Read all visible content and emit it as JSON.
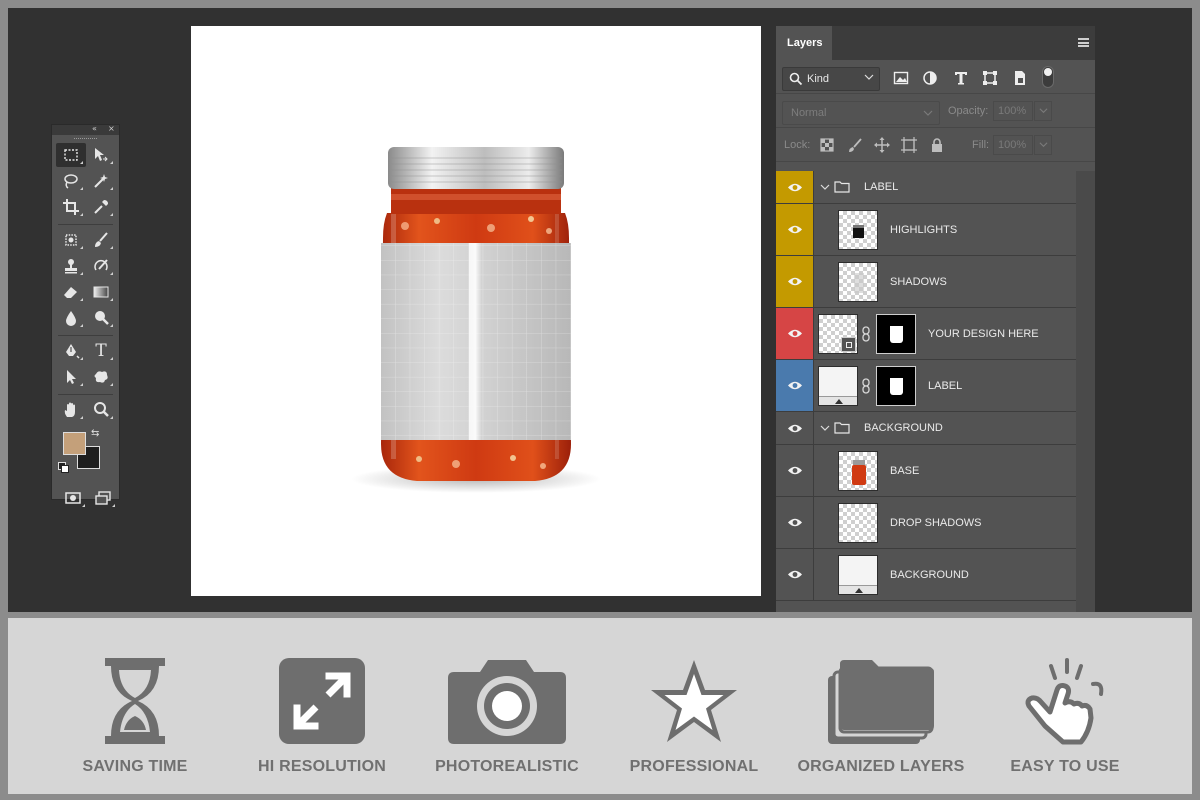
{
  "colors": {
    "workspace_bg": "#313131",
    "panel_bg": "#535353",
    "feature_bar_bg": "#d6d6d6",
    "feature_icon": "#6e6e6e",
    "foreground_swatch": "#c4a07a",
    "background_swatch": "#1e1e1e",
    "label_gold": "#c49a00",
    "label_red": "#d64545",
    "label_blue": "#4a7aad"
  },
  "tools_panel": {
    "collapse_glyph": "«",
    "close_glyph": "×",
    "tools": [
      [
        "marquee-icon",
        "move-icon"
      ],
      [
        "lasso-icon",
        "magic-wand-icon"
      ],
      [
        "crop-icon",
        "eyedropper-icon"
      ],
      [
        "healing-icon",
        "brush-icon"
      ],
      [
        "stamp-icon",
        "history-brush-icon"
      ],
      [
        "eraser-icon",
        "gradient-icon"
      ],
      [
        "blur-icon",
        "dodge-icon"
      ],
      [
        "pen-icon",
        "type-icon"
      ],
      [
        "path-select-icon",
        "shape-icon"
      ],
      [
        "hand-icon",
        "zoom-icon"
      ]
    ],
    "type_tool_glyph": "T",
    "swap_glyph": "⇆"
  },
  "layers_panel": {
    "tab_label": "Layers",
    "filter_kind": "Kind",
    "blend_mode": "Normal",
    "opacity_label": "Opacity:",
    "opacity_value": "100%",
    "lock_label": "Lock:",
    "fill_label": "Fill:",
    "fill_value": "100%",
    "layers": [
      {
        "name": "LABEL",
        "kind": "group",
        "label_color": "gold",
        "indent": 0
      },
      {
        "name": "HIGHLIGHTS",
        "kind": "layer",
        "label_color": "gold",
        "indent": 1,
        "thumb": "highlights"
      },
      {
        "name": "SHADOWS",
        "kind": "layer",
        "label_color": "gold",
        "indent": 1,
        "thumb": "shadows"
      },
      {
        "name": "YOUR DESIGN HERE",
        "kind": "layer",
        "label_color": "red",
        "indent": 0,
        "thumb": "smart",
        "mask": true
      },
      {
        "name": "LABEL",
        "kind": "layer",
        "label_color": "blue",
        "indent": 0,
        "thumb": "light",
        "mask": true
      },
      {
        "name": "BACKGROUND",
        "kind": "group",
        "label_color": "none",
        "indent": 0
      },
      {
        "name": "BASE",
        "kind": "layer",
        "label_color": "none",
        "indent": 1,
        "thumb": "base"
      },
      {
        "name": "DROP SHADOWS",
        "kind": "layer",
        "label_color": "none",
        "indent": 1,
        "thumb": "empty"
      },
      {
        "name": "BACKGROUND",
        "kind": "layer",
        "label_color": "none",
        "indent": 1,
        "thumb": "light"
      }
    ]
  },
  "features": [
    {
      "label": "SAVING TIME",
      "icon": "hourglass-icon"
    },
    {
      "label": "HI RESOLUTION",
      "icon": "expand-icon"
    },
    {
      "label": "PHOTOREALISTIC",
      "icon": "camera-icon"
    },
    {
      "label": "PROFESSIONAL",
      "icon": "star-icon"
    },
    {
      "label": "ORGANIZED LAYERS",
      "icon": "folders-icon"
    },
    {
      "label": "EASY TO USE",
      "icon": "tap-hand-icon"
    }
  ]
}
